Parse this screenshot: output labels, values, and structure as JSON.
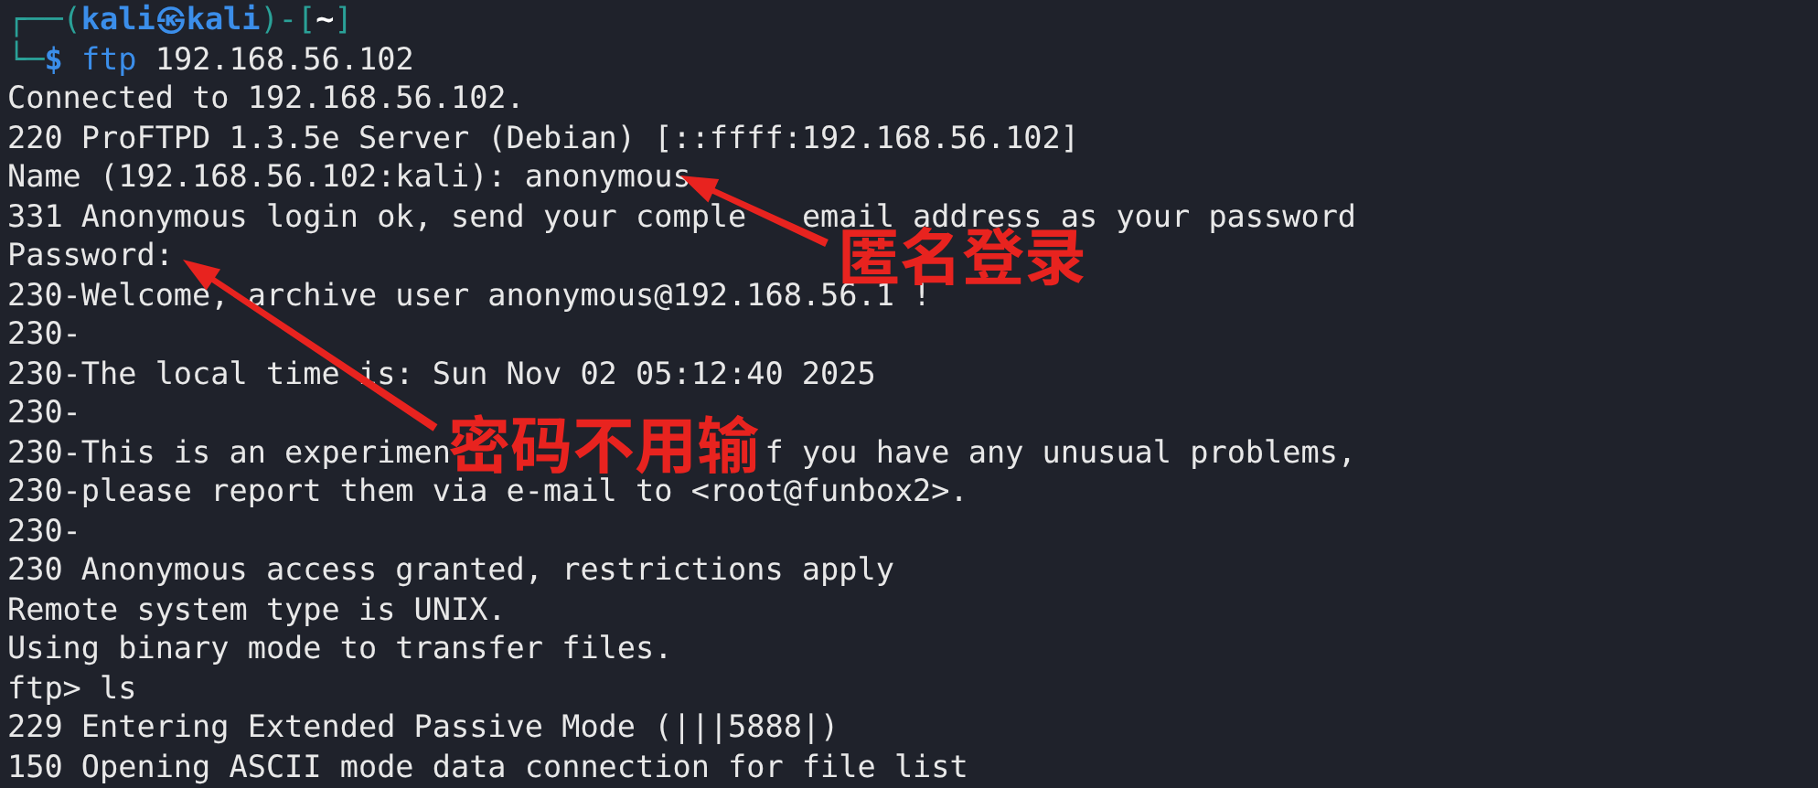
{
  "terminal": {
    "prompt": {
      "frame_top": "┌──(",
      "user": "kali",
      "at_sign": "㉿",
      "host": "kali",
      "separator": ")-[",
      "directory": "~",
      "close": "]",
      "frame_bottom": "└─",
      "symbol": "$"
    },
    "command": {
      "program": "ftp",
      "args": "192.168.56.102"
    },
    "output": [
      {
        "text": "Connected to 192.168.56.102."
      },
      {
        "text": "220 ProFTPD 1.3.5e Server (Debian) [::ffff:192.168.56.102]"
      },
      {
        "text": "Name (192.168.56.102:kali): anonymous"
      },
      {
        "parts": [
          "331 Anonymous login ok, send your comple",
          "email address as your password"
        ]
      },
      {
        "text": "Password:"
      },
      {
        "text": "230-Welcome, archive user anonymous@192.168.56.1 !"
      },
      {
        "text": "230-"
      },
      {
        "text": "230-The local time is: Sun Nov 02 05:12:40 2025"
      },
      {
        "text": "230-"
      },
      {
        "parts": [
          "230-This is an experimen",
          "f you have any unusual problems,"
        ]
      },
      {
        "text": "230-please report them via e-mail to <root@funbox2>."
      },
      {
        "text": "230-"
      },
      {
        "text": "230 Anonymous access granted, restrictions apply"
      },
      {
        "text": "Remote system type is UNIX."
      },
      {
        "text": "Using binary mode to transfer files."
      },
      {
        "text": "ftp> ls"
      },
      {
        "text": "229 Entering Extended Passive Mode (|||5888|)"
      },
      {
        "text": "150 Opening ASCII mode data connection for file list"
      }
    ]
  },
  "annotations": [
    {
      "label": "匿名登录"
    },
    {
      "label": "密码不用输"
    }
  ]
}
